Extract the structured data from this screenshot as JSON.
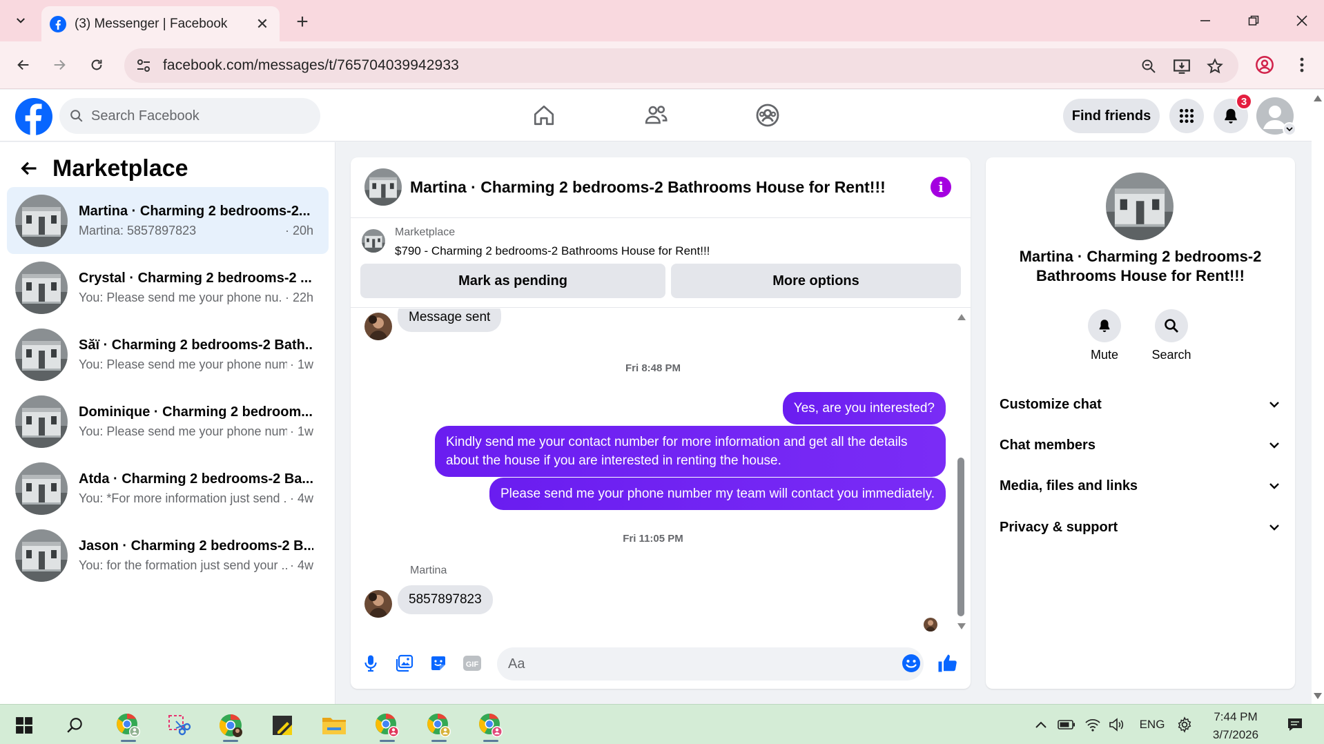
{
  "browser": {
    "tab_title": "(3) Messenger | Facebook",
    "url": "facebook.com/messages/t/765704039942933"
  },
  "header": {
    "search_placeholder": "Search Facebook",
    "find_friends_label": "Find friends",
    "notification_count": "3"
  },
  "sidebar": {
    "title": "Marketplace",
    "conversations": [
      {
        "name": "Martina · Charming 2 bedrooms-2...",
        "preview": "Martina: 5857897823",
        "time": "· 20h",
        "active": true
      },
      {
        "name": "Crystal · Charming 2 bedrooms-2 ...",
        "preview": "You: Please send me your phone nu...",
        "time": "· 22h",
        "active": false
      },
      {
        "name": "Săï · Charming 2 bedrooms-2 Bath...",
        "preview": "You: Please send me your phone num...",
        "time": "· 1w",
        "active": false
      },
      {
        "name": "Dominique · Charming 2 bedroom...",
        "preview": "You: Please send me your phone num...",
        "time": "· 1w",
        "active": false
      },
      {
        "name": "Atda · Charming 2 bedrooms-2 Ba...",
        "preview": "You: *For more information just send ...",
        "time": "· 4w",
        "active": false
      },
      {
        "name": "Jason · Charming 2 bedrooms-2 B...",
        "preview": "You: for the formation just send your ...",
        "time": "· 4w",
        "active": false
      }
    ]
  },
  "chat": {
    "title": "Martina · Charming 2 bedrooms-2 Bathrooms House for Rent!!!",
    "marketplace_label": "Marketplace",
    "listing": "$790 - Charming 2 bedrooms-2 Bathrooms House for Rent!!!",
    "mark_pending_label": "Mark as pending",
    "more_options_label": "More options",
    "messages": {
      "in_1": "Message sent",
      "time_1": "Fri 8:48 PM",
      "out_1": "Yes, are you interested?",
      "out_2": "Kindly send me your contact number for more information and get all the details about the house if you are interested in renting the house.",
      "out_3": "Please send me your phone number my team will contact you immediately.",
      "time_2": "Fri 11:05 PM",
      "sender": "Martina",
      "in_2": "5857897823"
    },
    "composer_placeholder": "Aa"
  },
  "details": {
    "title": "Martina · Charming 2 bedrooms-2 Bathrooms House for Rent!!!",
    "mute_label": "Mute",
    "search_label": "Search",
    "sections": [
      "Customize chat",
      "Chat members",
      "Media, files and links",
      "Privacy & support"
    ]
  },
  "taskbar": {
    "language": "ENG",
    "time": "7:44 PM",
    "date": "3/7/2026"
  },
  "colors": {
    "fb_blue": "#0866ff",
    "messenger_purple": "#7a2cf6",
    "active_row": "#e7f1fc",
    "badge_red": "#e41e3f"
  }
}
